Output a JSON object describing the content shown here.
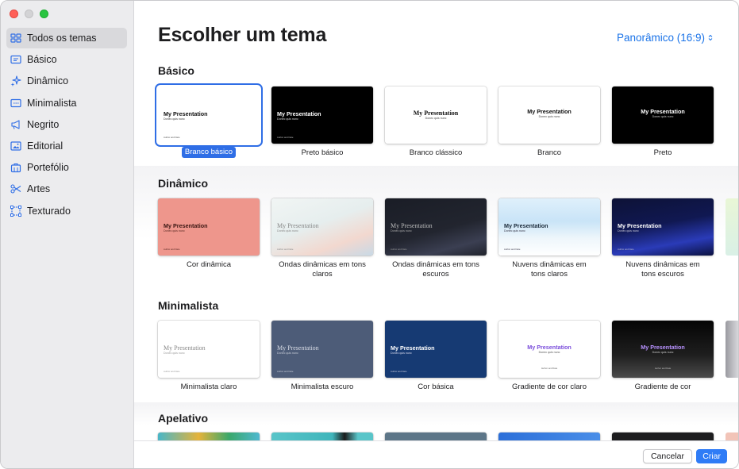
{
  "sidebar": {
    "items": [
      {
        "label": "Todos os temas",
        "icon": "grid-icon",
        "active": true
      },
      {
        "label": "Básico",
        "icon": "basic-slide-icon"
      },
      {
        "label": "Dinâmico",
        "icon": "sparkles-icon"
      },
      {
        "label": "Minimalista",
        "icon": "minimal-slide-icon"
      },
      {
        "label": "Negrito",
        "icon": "megaphone-icon"
      },
      {
        "label": "Editorial",
        "icon": "photo-icon"
      },
      {
        "label": "Portefólio",
        "icon": "briefcase-icon"
      },
      {
        "label": "Artes",
        "icon": "scissors-icon"
      },
      {
        "label": "Texturado",
        "icon": "textured-frame-icon"
      }
    ]
  },
  "header": {
    "title": "Escolher um tema",
    "size_select": "Panorâmico (16:9)"
  },
  "thumb_text": {
    "title": "My Presentation",
    "subtitle": "Donec quis nunc",
    "author": "Author and Date"
  },
  "sections": [
    {
      "title": "Básico",
      "themes": [
        {
          "label": "Branco básico",
          "selected": true
        },
        {
          "label": "Preto básico"
        },
        {
          "label": "Branco clássico"
        },
        {
          "label": "Branco"
        },
        {
          "label": "Preto"
        }
      ]
    },
    {
      "title": "Dinâmico",
      "themes": [
        {
          "label": "Cor dinâmica"
        },
        {
          "label": "Ondas dinâmicas em tons claros"
        },
        {
          "label": "Ondas dinâmicas em tons escuros"
        },
        {
          "label": "Nuvens dinâmicas em tons claros"
        },
        {
          "label": "Nuvens dinâmicas em tons escuros"
        }
      ]
    },
    {
      "title": "Minimalista",
      "themes": [
        {
          "label": "Minimalista claro"
        },
        {
          "label": "Minimalista escuro"
        },
        {
          "label": "Cor básica"
        },
        {
          "label": "Gradiente de cor claro"
        },
        {
          "label": "Gradiente de cor"
        }
      ]
    },
    {
      "title": "Apelativo",
      "themes": [
        {
          "label": ""
        },
        {
          "label": ""
        },
        {
          "label": ""
        },
        {
          "label": ""
        },
        {
          "label": ""
        }
      ]
    }
  ],
  "footer": {
    "cancel_label": "Cancelar",
    "create_label": "Criar"
  },
  "colors": {
    "accent": "#2f6ee6",
    "create_button": "#2f7cf6",
    "link": "#1a73e8"
  }
}
